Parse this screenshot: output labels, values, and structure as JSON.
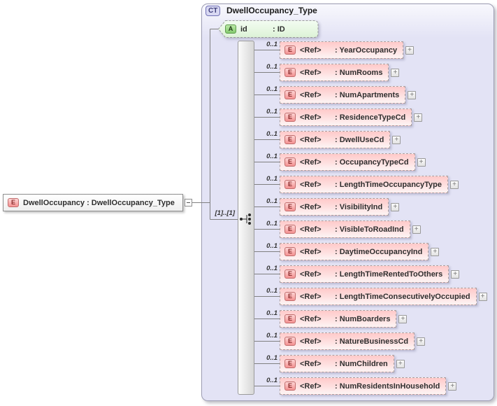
{
  "colors": {
    "container_fill_top": "#f8f8fd",
    "container_fill": "#e3e3f5",
    "container_border": "#9d9db3",
    "ct_badge_fill": "#d8d8f2",
    "ct_badge_border": "#7171b5",
    "ct_badge_text": "#3d3d7a",
    "title_text": "#1a1a1a",
    "box_text": "#2e2e2e",
    "cardinality_text": "#333333",
    "line": "#808080",
    "bar_fill_left": "#fbfbfb",
    "bar_fill_right": "#d7d7d7",
    "bar_border": "#9a9a9a",
    "row_fill_top": "#ffc9c9",
    "row_fill_bottom": "#fdf4f4",
    "row_border": "#ab9f9f",
    "e_icon_top": "#ffd6d6",
    "e_icon_bottom": "#f49090",
    "e_icon_border": "#c06d6d",
    "e_icon_text": "#8a2c2c",
    "a_icon_top": "#bce8a8",
    "a_icon_bottom": "#84cb6e",
    "a_icon_border": "#5e9c4c",
    "a_icon_text": "#223a1a",
    "plus_border": "#999999",
    "plus_fill_top": "#fcfcfc",
    "plus_fill_bottom": "#e2e2e2",
    "plus_text": "#777777",
    "root_fill_top": "#ffffff",
    "root_fill_bottom": "#efefef",
    "root_border": "#8f8f8f"
  },
  "diagram": {
    "icons": {
      "element": "E",
      "attribute": "A"
    },
    "controls": {
      "expand_symbol": "+"
    },
    "complex_type": {
      "badge": "CT",
      "title": "DwellOccupancy_Type"
    },
    "root_element": {
      "label": "DwellOccupancy : DwellOccupancy_Type"
    },
    "attribute": {
      "name": "id",
      "type": ": ID"
    },
    "sequence": {
      "multiplicity": "[1]..[1]"
    },
    "elements": [
      {
        "cardinality": "0..1",
        "ref": "<Ref>",
        "name": ": YearOccupancy"
      },
      {
        "cardinality": "0..1",
        "ref": "<Ref>",
        "name": ": NumRooms"
      },
      {
        "cardinality": "0..1",
        "ref": "<Ref>",
        "name": ": NumApartments"
      },
      {
        "cardinality": "0..1",
        "ref": "<Ref>",
        "name": ": ResidenceTypeCd"
      },
      {
        "cardinality": "0..1",
        "ref": "<Ref>",
        "name": ": DwellUseCd"
      },
      {
        "cardinality": "0..1",
        "ref": "<Ref>",
        "name": ": OccupancyTypeCd"
      },
      {
        "cardinality": "0..1",
        "ref": "<Ref>",
        "name": ": LengthTimeOccupancyType"
      },
      {
        "cardinality": "0..1",
        "ref": "<Ref>",
        "name": ": VisibilityInd"
      },
      {
        "cardinality": "0..1",
        "ref": "<Ref>",
        "name": ": VisibleToRoadInd"
      },
      {
        "cardinality": "0..1",
        "ref": "<Ref>",
        "name": ": DaytimeOccupancyInd"
      },
      {
        "cardinality": "0..1",
        "ref": "<Ref>",
        "name": ": LengthTimeRentedToOthers"
      },
      {
        "cardinality": "0..1",
        "ref": "<Ref>",
        "name": ": LengthTimeConsecutivelyOccupied"
      },
      {
        "cardinality": "0..1",
        "ref": "<Ref>",
        "name": ": NumBoarders"
      },
      {
        "cardinality": "0..1",
        "ref": "<Ref>",
        "name": ": NatureBusinessCd"
      },
      {
        "cardinality": "0..1",
        "ref": "<Ref>",
        "name": ": NumChildren"
      },
      {
        "cardinality": "0..1",
        "ref": "<Ref>",
        "name": ": NumResidentsInHousehold"
      }
    ]
  }
}
